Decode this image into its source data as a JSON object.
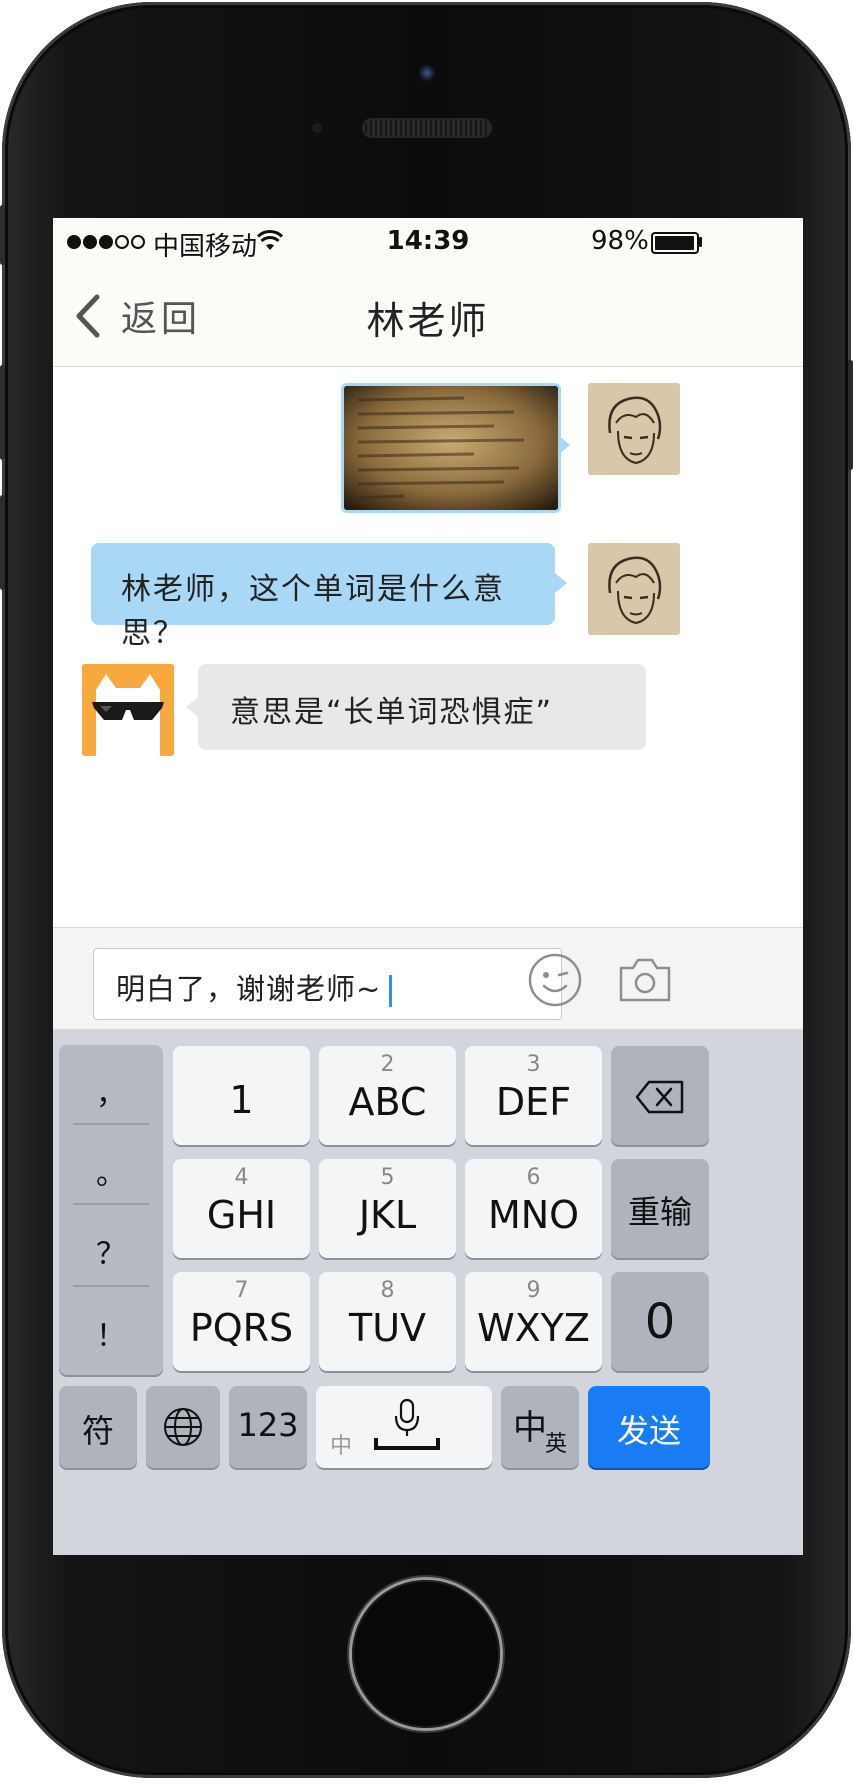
{
  "status_bar": {
    "carrier": "中国移动",
    "time": "14:39",
    "battery": "98%"
  },
  "nav": {
    "back_label": "返回",
    "title": "林老师"
  },
  "messages": [
    {
      "sender": "me",
      "type": "image"
    },
    {
      "sender": "me",
      "type": "text",
      "text": "林老师，这个单词是什么意思？"
    },
    {
      "sender": "teacher",
      "type": "text",
      "text": "意思是“长单词恐惧症”"
    }
  ],
  "input": {
    "value": "明白了，谢谢老师~"
  },
  "keyboard": {
    "punctuation": [
      "，",
      "。",
      "？",
      "！"
    ],
    "keys": [
      {
        "digit": "",
        "main": "1"
      },
      {
        "digit": "2",
        "main": "ABC"
      },
      {
        "digit": "3",
        "main": "DEF"
      },
      {
        "digit": "4",
        "main": "GHI"
      },
      {
        "digit": "5",
        "main": "JKL"
      },
      {
        "digit": "6",
        "main": "MNO"
      },
      {
        "digit": "7",
        "main": "PQRS"
      },
      {
        "digit": "8",
        "main": "TUV"
      },
      {
        "digit": "9",
        "main": "WXYZ"
      }
    ],
    "reinput": "重输",
    "zero": "0",
    "symbols": "符",
    "numbers": "123",
    "space_hint": "中",
    "lang_main": "中",
    "lang_sub": "英",
    "send": "发送"
  },
  "colors": {
    "send_button": "#1a7cf5",
    "my_bubble": "#a9d8f6",
    "their_bubble": "#e8e8e8",
    "caret": "#3b8cf0"
  }
}
